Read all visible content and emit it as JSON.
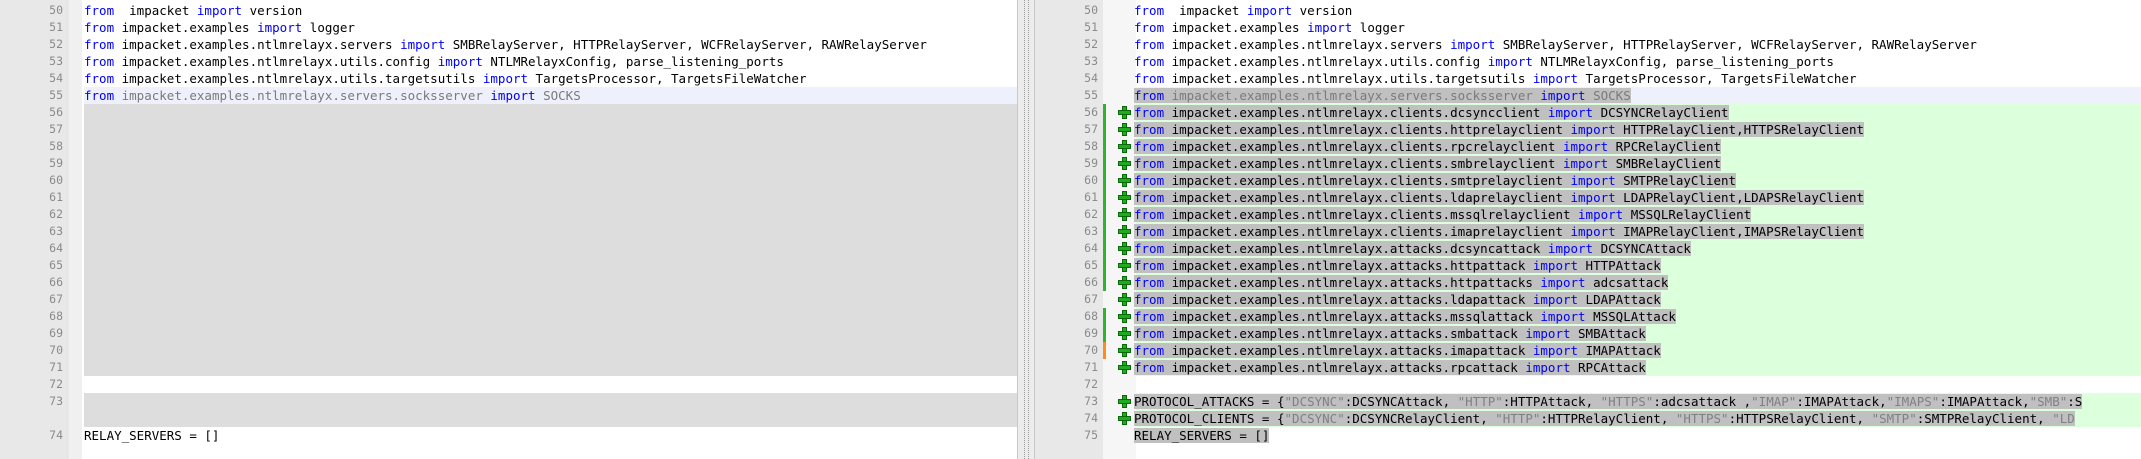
{
  "left": {
    "lines": [
      {
        "n": "50",
        "bg": "",
        "tokens": [
          [
            "kw",
            "from"
          ],
          [
            "",
            "  impacket "
          ],
          [
            "kw",
            "import"
          ],
          [
            "",
            " version"
          ]
        ]
      },
      {
        "n": "51",
        "bg": "",
        "tokens": [
          [
            "kw",
            "from"
          ],
          [
            "",
            " impacket.examples "
          ],
          [
            "kw",
            "import"
          ],
          [
            "",
            " logger"
          ]
        ]
      },
      {
        "n": "52",
        "bg": "",
        "tokens": [
          [
            "kw",
            "from"
          ],
          [
            "",
            " impacket.examples.ntlmrelayx.servers "
          ],
          [
            "kw",
            "import"
          ],
          [
            "",
            " SMBRelayServer, HTTPRelayServer, WCFRelayServer, RAWRelayServer"
          ]
        ]
      },
      {
        "n": "53",
        "bg": "",
        "tokens": [
          [
            "kw",
            "from"
          ],
          [
            "",
            " impacket.examples.ntlmrelayx.utils.config "
          ],
          [
            "kw",
            "import"
          ],
          [
            "",
            " NTLMRelayxConfig, parse_listening_ports"
          ]
        ]
      },
      {
        "n": "54",
        "bg": "",
        "tokens": [
          [
            "kw",
            "from"
          ],
          [
            "",
            " impacket.examples.ntlmrelayx.utils.targetsutils "
          ],
          [
            "kw",
            "import"
          ],
          [
            "",
            " TargetsProcessor, TargetsFileWatcher"
          ]
        ]
      },
      {
        "n": "55",
        "bg": "cur",
        "tokens": [
          [
            "kw",
            "from"
          ],
          [
            "hl-light",
            " impacket.examples.ntlmrelayx.servers.socksserver "
          ],
          [
            "kw",
            "import"
          ],
          [
            "hl-light",
            " SOCKS"
          ]
        ]
      },
      {
        "n": "56",
        "bg": "gray",
        "tokens": []
      },
      {
        "n": "57",
        "bg": "gray",
        "tokens": []
      },
      {
        "n": "58",
        "bg": "gray",
        "tokens": []
      },
      {
        "n": "59",
        "bg": "gray",
        "tokens": []
      },
      {
        "n": "60",
        "bg": "gray",
        "tokens": []
      },
      {
        "n": "61",
        "bg": "gray",
        "tokens": []
      },
      {
        "n": "62",
        "bg": "gray",
        "tokens": []
      },
      {
        "n": "63",
        "bg": "gray",
        "tokens": []
      },
      {
        "n": "64",
        "bg": "gray",
        "tokens": []
      },
      {
        "n": "65",
        "bg": "gray",
        "tokens": []
      },
      {
        "n": "66",
        "bg": "gray",
        "tokens": []
      },
      {
        "n": "67",
        "bg": "gray",
        "tokens": []
      },
      {
        "n": "68",
        "bg": "gray",
        "tokens": []
      },
      {
        "n": "69",
        "bg": "gray",
        "tokens": []
      },
      {
        "n": "70",
        "bg": "gray",
        "tokens": []
      },
      {
        "n": "71",
        "bg": "gray",
        "tokens": []
      },
      {
        "n": "72",
        "bg": "",
        "tokens": []
      },
      {
        "n": "73",
        "bg": "gray",
        "tokens": []
      },
      {
        "n": "",
        "bg": "gray",
        "tokens": []
      },
      {
        "n": "74",
        "bg": "",
        "tokens": [
          [
            "",
            "RELAY_SERVERS = []"
          ]
        ]
      }
    ]
  },
  "right": {
    "lines": [
      {
        "n": "50",
        "bg": "",
        "mark": "",
        "tokens": [
          [
            "kw",
            "from"
          ],
          [
            "",
            "  impacket "
          ],
          [
            "kw",
            "import"
          ],
          [
            "",
            " version"
          ]
        ]
      },
      {
        "n": "51",
        "bg": "",
        "mark": "",
        "tokens": [
          [
            "kw",
            "from"
          ],
          [
            "",
            " impacket.examples "
          ],
          [
            "kw",
            "import"
          ],
          [
            "",
            " logger"
          ]
        ]
      },
      {
        "n": "52",
        "bg": "",
        "mark": "",
        "tokens": [
          [
            "kw",
            "from"
          ],
          [
            "",
            " impacket.examples.ntlmrelayx.servers "
          ],
          [
            "kw",
            "import"
          ],
          [
            "",
            " SMBRelayServer, HTTPRelayServer, WCFRelayServer, RAWRelayServer"
          ]
        ]
      },
      {
        "n": "53",
        "bg": "",
        "mark": "",
        "tokens": [
          [
            "kw",
            "from"
          ],
          [
            "",
            " impacket.examples.ntlmrelayx.utils.config "
          ],
          [
            "kw",
            "import"
          ],
          [
            "",
            " NTLMRelayxConfig, parse_listening_ports"
          ]
        ]
      },
      {
        "n": "54",
        "bg": "",
        "mark": "",
        "tokens": [
          [
            "kw",
            "from"
          ],
          [
            "",
            " impacket.examples.ntlmrelayx.utils.targetsutils "
          ],
          [
            "kw",
            "import"
          ],
          [
            "",
            " TargetsProcessor, TargetsFileWatcher"
          ]
        ]
      },
      {
        "n": "55",
        "bg": "cur",
        "mark": "",
        "tokens": [
          [
            "kw hl",
            "from"
          ],
          [
            "hl-light hl",
            " impacket.examples.ntlmrelayx.servers.socksserver "
          ],
          [
            "kw hl",
            "import"
          ],
          [
            "hl-light hl",
            " SOCKS"
          ]
        ]
      },
      {
        "n": "56",
        "bg": "green",
        "mark": "plus",
        "tokens": [
          [
            "kw hl",
            "from"
          ],
          [
            "hl",
            " impacket.examples.ntlmrelayx.clients.dcsyncclient "
          ],
          [
            "kw hl",
            "import"
          ],
          [
            "hl",
            " DCSYNCRelayClient"
          ]
        ]
      },
      {
        "n": "57",
        "bg": "green",
        "mark": "plus",
        "tokens": [
          [
            "kw hl",
            "from"
          ],
          [
            "hl",
            " impacket.examples.ntlmrelayx.clients.httprelayclient "
          ],
          [
            "kw hl",
            "import"
          ],
          [
            "hl",
            " HTTPRelayClient,HTTPSRelayClient"
          ]
        ]
      },
      {
        "n": "58",
        "bg": "green",
        "mark": "plus",
        "tokens": [
          [
            "kw hl",
            "from"
          ],
          [
            "hl",
            " impacket.examples.ntlmrelayx.clients.rpcrelayclient "
          ],
          [
            "kw hl",
            "import"
          ],
          [
            "hl",
            " RPCRelayClient"
          ]
        ]
      },
      {
        "n": "59",
        "bg": "green",
        "mark": "plus",
        "tokens": [
          [
            "kw hl",
            "from"
          ],
          [
            "hl",
            " impacket.examples.ntlmrelayx.clients.smbrelayclient "
          ],
          [
            "kw hl",
            "import"
          ],
          [
            "hl",
            " SMBRelayClient"
          ]
        ]
      },
      {
        "n": "60",
        "bg": "green",
        "mark": "plus",
        "tokens": [
          [
            "kw hl",
            "from"
          ],
          [
            "hl",
            " impacket.examples.ntlmrelayx.clients.smtprelayclient "
          ],
          [
            "kw hl",
            "import"
          ],
          [
            "hl",
            " SMTPRelayClient"
          ]
        ]
      },
      {
        "n": "61",
        "bg": "green",
        "mark": "plus",
        "tokens": [
          [
            "kw hl",
            "from"
          ],
          [
            "hl",
            " impacket.examples.ntlmrelayx.clients.ldaprelayclient "
          ],
          [
            "kw hl",
            "import"
          ],
          [
            "hl",
            " LDAPRelayClient,LDAPSRelayClient"
          ]
        ]
      },
      {
        "n": "62",
        "bg": "green",
        "mark": "plus",
        "tokens": [
          [
            "kw hl",
            "from"
          ],
          [
            "hl",
            " impacket.examples.ntlmrelayx.clients.mssqlrelayclient "
          ],
          [
            "kw hl",
            "import"
          ],
          [
            "hl",
            " MSSQLRelayClient"
          ]
        ]
      },
      {
        "n": "63",
        "bg": "green",
        "mark": "plus",
        "tokens": [
          [
            "kw hl",
            "from"
          ],
          [
            "hl",
            " impacket.examples.ntlmrelayx.clients.imaprelayclient "
          ],
          [
            "kw hl",
            "import"
          ],
          [
            "hl",
            " IMAPRelayClient,IMAPSRelayClient"
          ]
        ]
      },
      {
        "n": "64",
        "bg": "green",
        "mark": "plus",
        "tokens": [
          [
            "kw hl",
            "from"
          ],
          [
            "hl",
            " impacket.examples.ntlmrelayx.attacks.dcsyncattack "
          ],
          [
            "kw hl",
            "import"
          ],
          [
            "hl",
            " DCSYNCAttack"
          ]
        ]
      },
      {
        "n": "65",
        "bg": "green",
        "mark": "plus",
        "tokens": [
          [
            "kw hl",
            "from"
          ],
          [
            "hl",
            " impacket.examples.ntlmrelayx.attacks.httpattack "
          ],
          [
            "kw hl",
            "import"
          ],
          [
            "hl",
            " HTTPAttack"
          ]
        ]
      },
      {
        "n": "66",
        "bg": "green",
        "mark": "plus",
        "tokens": [
          [
            "kw hl",
            "from"
          ],
          [
            "hl",
            " impacket.examples.ntlmrelayx.attacks.httpattacks "
          ],
          [
            "kw hl",
            "import"
          ],
          [
            "hl",
            " adcsattack"
          ]
        ]
      },
      {
        "n": "67",
        "bg": "green",
        "mark": "plus",
        "tokens": [
          [
            "kw hl",
            "from"
          ],
          [
            "hl",
            " impacket.examples.ntlmrelayx.attacks.ldapattack "
          ],
          [
            "kw hl",
            "import"
          ],
          [
            "hl",
            " LDAPAttack"
          ]
        ]
      },
      {
        "n": "68",
        "bg": "green",
        "mark": "plus",
        "tokens": [
          [
            "kw hl",
            "from"
          ],
          [
            "hl",
            " impacket.examples.ntlmrelayx.attacks.mssqlattack "
          ],
          [
            "kw hl",
            "import"
          ],
          [
            "hl",
            " MSSQLAttack"
          ]
        ]
      },
      {
        "n": "69",
        "bg": "green",
        "mark": "plus",
        "tokens": [
          [
            "kw hl",
            "from"
          ],
          [
            "hl",
            " impacket.examples.ntlmrelayx.attacks.smbattack "
          ],
          [
            "kw hl",
            "import"
          ],
          [
            "hl",
            " SMBAttack"
          ]
        ]
      },
      {
        "n": "70",
        "bg": "green",
        "mark": "plus",
        "tokens": [
          [
            "kw hl",
            "from"
          ],
          [
            "hl",
            " impacket.examples.ntlmrelayx.attacks.imapattack "
          ],
          [
            "kw hl",
            "import"
          ],
          [
            "hl",
            " IMAPAttack"
          ]
        ]
      },
      {
        "n": "71",
        "bg": "green",
        "mark": "plus",
        "tokens": [
          [
            "kw hl",
            "from"
          ],
          [
            "hl",
            " impacket.examples.ntlmrelayx.attacks.rpcattack "
          ],
          [
            "kw hl",
            "import"
          ],
          [
            "hl",
            " RPCAttack"
          ]
        ]
      },
      {
        "n": "72",
        "bg": "",
        "mark": "",
        "tokens": []
      },
      {
        "n": "73",
        "bg": "green",
        "mark": "plus",
        "tokens": [
          [
            "hl",
            "PROTOCOL_ATTACKS = {"
          ],
          [
            "str hl",
            "\"DCSYNC\""
          ],
          [
            "hl",
            ":DCSYNCAttack, "
          ],
          [
            "str hl",
            "\"HTTP\""
          ],
          [
            "hl",
            ":HTTPAttack, "
          ],
          [
            "str hl",
            "\"HTTPS\""
          ],
          [
            "hl",
            ":adcsattack ,"
          ],
          [
            "str hl",
            "\"IMAP\""
          ],
          [
            "hl",
            ":IMAPAttack,"
          ],
          [
            "str hl",
            "\"IMAPS\""
          ],
          [
            "hl",
            ":IMAPAttack,"
          ],
          [
            "str hl",
            "\"SMB\""
          ],
          [
            "hl",
            ":S"
          ]
        ]
      },
      {
        "n": "74",
        "bg": "green",
        "mark": "plus",
        "tokens": [
          [
            "hl",
            "PROTOCOL_CLIENTS = {"
          ],
          [
            "str hl",
            "\"DCSYNC\""
          ],
          [
            "hl",
            ":DCSYNCRelayClient, "
          ],
          [
            "str hl",
            "\"HTTP\""
          ],
          [
            "hl",
            ":HTTPRelayClient, "
          ],
          [
            "str hl",
            "\"HTTPS\""
          ],
          [
            "hl",
            ":HTTPSRelayClient, "
          ],
          [
            "str hl",
            "\"SMTP\""
          ],
          [
            "hl",
            ":SMTPRelayClient, "
          ],
          [
            "str hl",
            "\"LD"
          ]
        ]
      },
      {
        "n": "75",
        "bg": "",
        "mark": "",
        "tokens": [
          [
            "hl",
            "RELAY_SERVERS = []"
          ]
        ]
      }
    ]
  }
}
